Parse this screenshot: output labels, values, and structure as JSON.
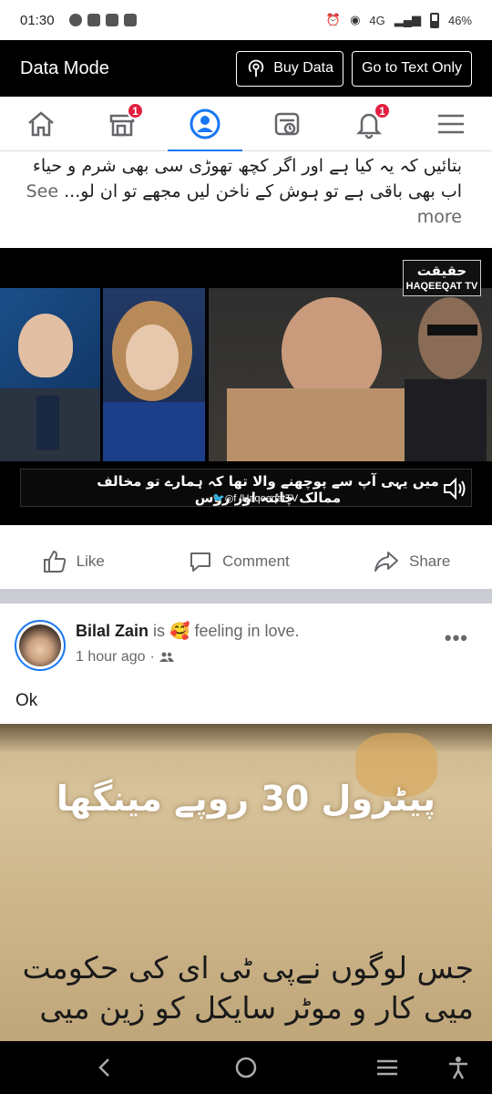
{
  "status_bar": {
    "time": "01:30",
    "network": "4G",
    "battery": "46%"
  },
  "data_mode": {
    "title": "Data Mode",
    "buy_data": "Buy Data",
    "text_only": "Go to Text Only"
  },
  "nav": {
    "marketplace_badge": "1",
    "notifications_badge": "1"
  },
  "post1": {
    "text": "بتائیں کہ یہ کیا ہے اور اگر کچھ تھوڑی سی بھی شرم و حیاء اب بھی باقی ہے تو ہوش کے ناخن لیں مجھے تو ان لو...",
    "see_more": "See more",
    "video": {
      "logo_ar": "حقیقت",
      "logo_en": "HAQEEQAT TV",
      "caption": "میں یہی آپ سے پوچھنے والا تھا کہ ہمارے تو مخالف ممالک چائنہ اور روس",
      "handle": "/HaqeeqatTV"
    },
    "actions": {
      "like": "Like",
      "comment": "Comment",
      "share": "Share"
    }
  },
  "post2": {
    "author": "Bilal Zain",
    "is": "is",
    "feeling_emoji": "🥰",
    "feeling": "feeling in love.",
    "time": "1 hour ago",
    "text": "Ok",
    "image": {
      "headline": "پیٹرول 30 روپے مینگھا",
      "body": "جس لوگوں نےپی ٹی ای کی حکومت میی کار و موٹر سایکل کو زین میی"
    }
  }
}
